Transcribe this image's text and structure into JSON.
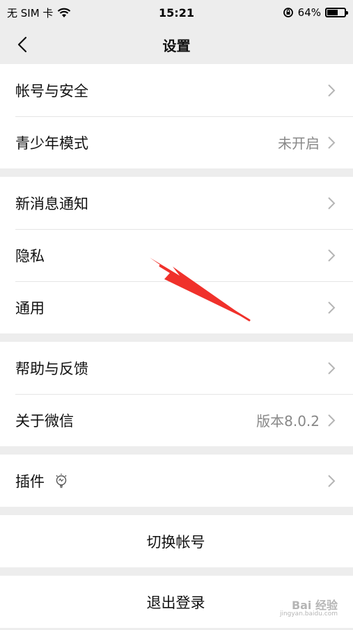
{
  "status_bar": {
    "carrier": "无 SIM 卡",
    "time": "15:21",
    "battery_percent": "64%",
    "battery_level": 0.64
  },
  "nav": {
    "title": "设置",
    "back_icon": "chevron-left-icon"
  },
  "groups": [
    {
      "items": [
        {
          "label": "帐号与安全",
          "value": ""
        },
        {
          "label": "青少年模式",
          "value": "未开启"
        }
      ]
    },
    {
      "items": [
        {
          "label": "新消息通知",
          "value": ""
        },
        {
          "label": "隐私",
          "value": ""
        },
        {
          "label": "通用",
          "value": ""
        }
      ]
    },
    {
      "items": [
        {
          "label": "帮助与反馈",
          "value": ""
        },
        {
          "label": "关于微信",
          "value": "版本8.0.2"
        }
      ]
    },
    {
      "items": [
        {
          "label": "插件",
          "value": "",
          "icon": "lightbulb-icon"
        }
      ]
    }
  ],
  "actions": {
    "switch_account": "切换帐号",
    "logout": "退出登录"
  },
  "watermark": {
    "text": "Bai 经验",
    "sub": "jingyan.baidu.com"
  },
  "colors": {
    "background": "#ededed",
    "annotation_arrow": "#f0312b"
  }
}
